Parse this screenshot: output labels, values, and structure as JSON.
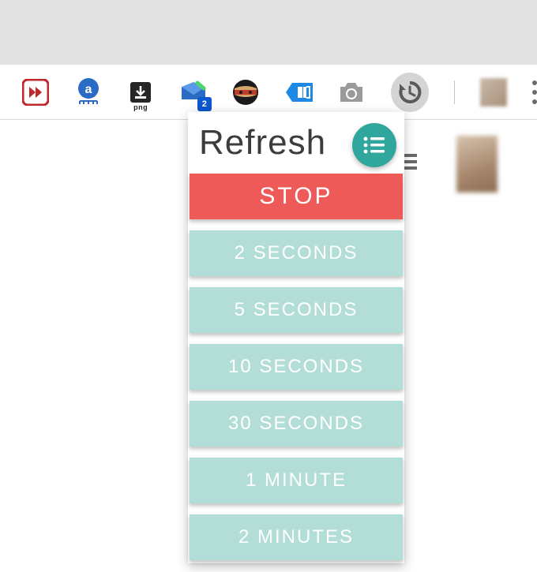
{
  "toolbar": {
    "icons": {
      "ff": "fast-forward-icon",
      "amazon": "amazon-assistant-icon",
      "png_label": "png",
      "messenger_badge": "2",
      "ninja": "ninja-icon",
      "tag": "tag-icon",
      "camera": "camera-icon",
      "history": "history-icon"
    }
  },
  "popup": {
    "title": "Refresh",
    "stop_label": "STOP",
    "intervals": [
      "2 SECONDS",
      "5 SECONDS",
      "10 SECONDS",
      "30 SECONDS",
      "1 MINUTE",
      "2 MINUTES"
    ]
  }
}
